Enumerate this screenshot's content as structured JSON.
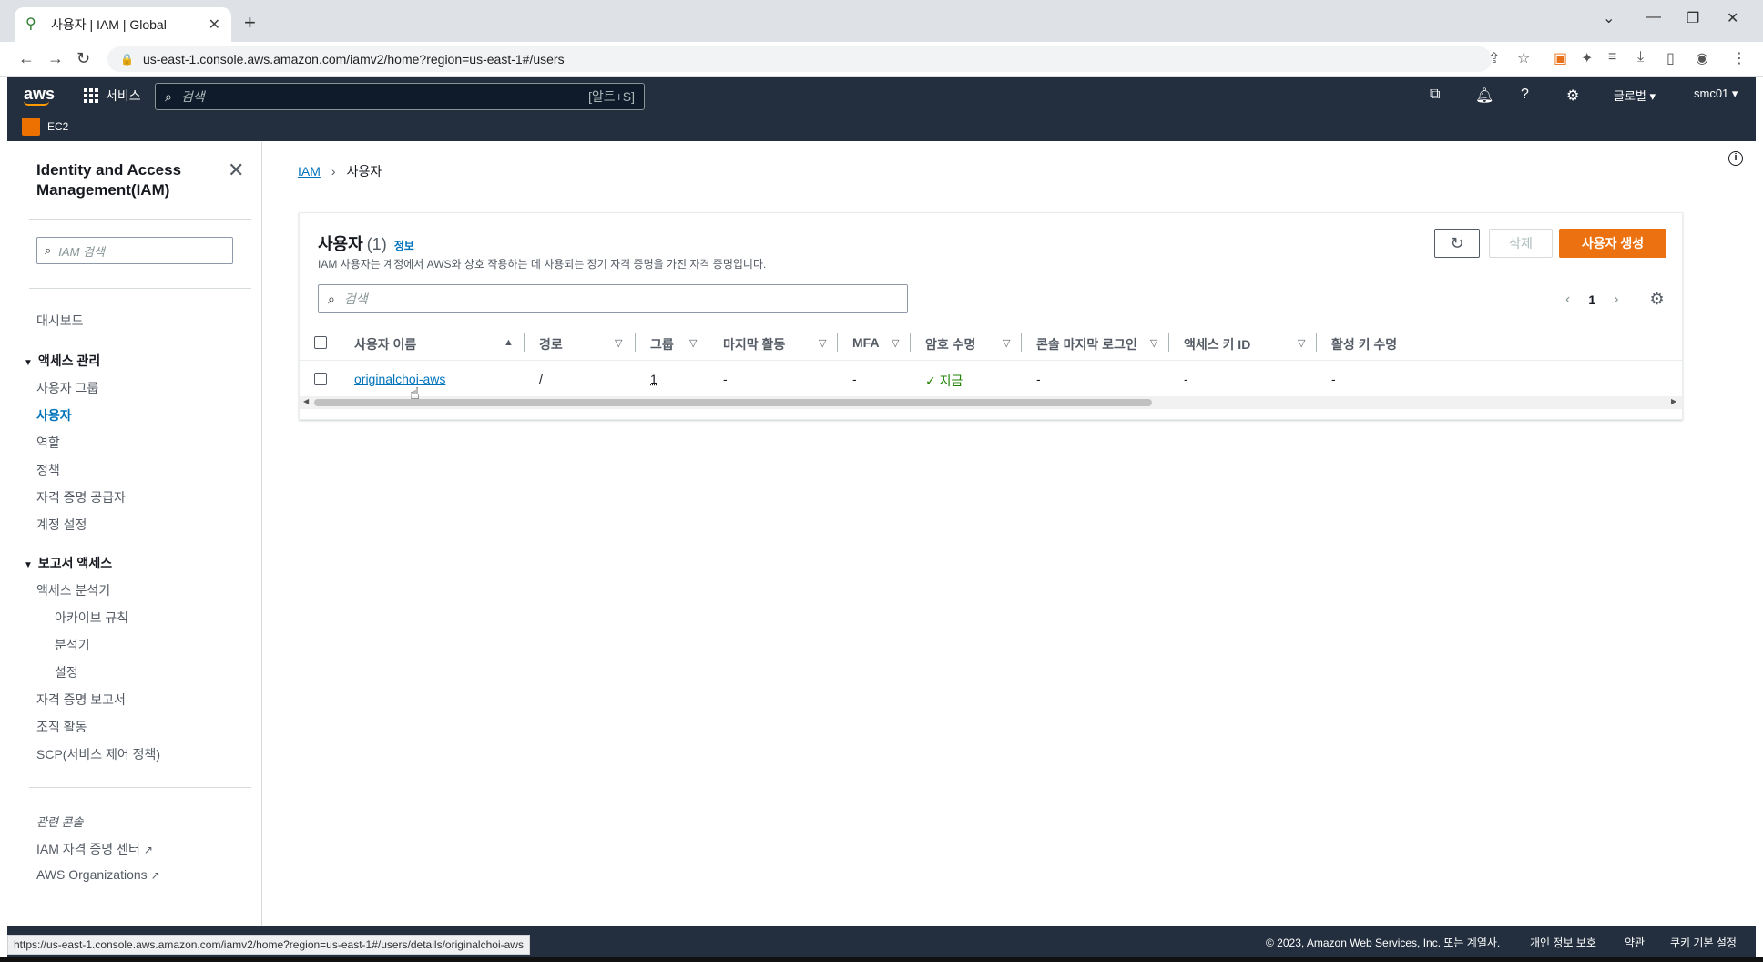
{
  "browser": {
    "tab_title": "사용자 | IAM | Global",
    "url": "us-east-1.console.aws.amazon.com/iamv2/home?region=us-east-1#/users",
    "status_url": "https://us-east-1.console.aws.amazon.com/iamv2/home?region=us-east-1#/users/details/originalchoi-aws"
  },
  "aws_header": {
    "logo": "aws",
    "services_label": "서비스",
    "search_placeholder": "검색",
    "search_shortcut": "[알트+S]",
    "region_label": "글로벌 ▾",
    "account_label": "smc01 ▾",
    "favorite_service": "EC2"
  },
  "sidebar": {
    "title": "Identity and Access Management(IAM)",
    "search_placeholder": "IAM 검색",
    "dashboard": "대시보드",
    "access_mgmt": {
      "label": "액세스 관리",
      "items": [
        "사용자 그룹",
        "사용자",
        "역할",
        "정책",
        "자격 증명 공급자",
        "계정 설정"
      ]
    },
    "access_reports": {
      "label": "보고서 액세스",
      "analyzer": "액세스 분석기",
      "sub_items": [
        "아카이브 규칙",
        "분석기",
        "설정"
      ],
      "items": [
        "자격 증명 보고서",
        "조직 활동",
        "SCP(서비스 제어 정책)"
      ]
    },
    "related_label": "관련 콘솔",
    "related": [
      "IAM 자격 증명 센터",
      "AWS Organizations"
    ]
  },
  "breadcrumb": {
    "root": "IAM",
    "current": "사용자"
  },
  "panel": {
    "title": "사용자",
    "count": "(1)",
    "info": "정보",
    "description": "IAM 사용자는 계정에서 AWS와 상호 작용하는 데 사용되는 장기 자격 증명을 가진 자격 증명입니다.",
    "delete_label": "삭제",
    "create_label": "사용자 생성",
    "search_placeholder": "검색",
    "page": "1",
    "columns": [
      "사용자 이름",
      "경로",
      "그룹",
      "마지막 활동",
      "MFA",
      "암호 수명",
      "콘솔 마지막 로그인",
      "액세스 키 ID",
      "활성 키 수명"
    ],
    "rows": [
      {
        "name": "originalchoi-aws",
        "path": "/",
        "groups": "1",
        "last_activity": "-",
        "mfa": "-",
        "pw_age": "지금",
        "console_login": "-",
        "access_key": "-",
        "key_age": "-"
      }
    ]
  },
  "footer": {
    "copyright": "© 2023, Amazon Web Services, Inc. 또는 계열사.",
    "privacy": "개인 정보 보호",
    "terms": "약관",
    "cookies": "쿠키 기본 설정"
  }
}
